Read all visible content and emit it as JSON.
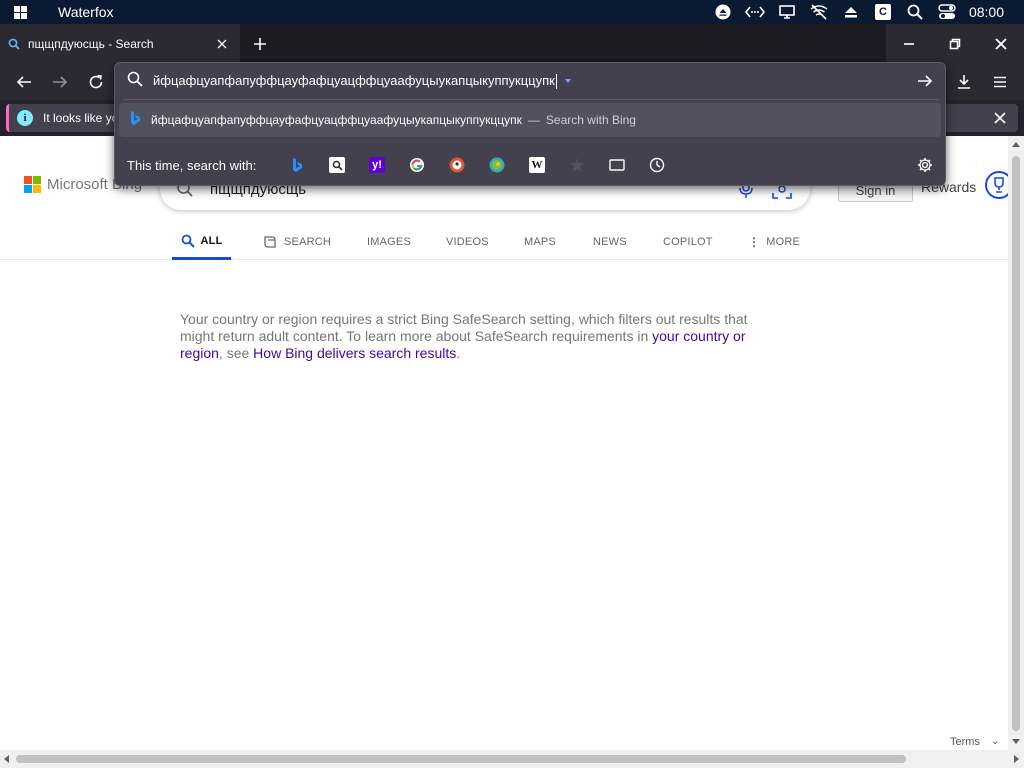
{
  "os": {
    "title": "Waterfox",
    "clock": "08:00",
    "tray_icons": [
      "eject-circle-icon",
      "network-code-icon",
      "monitor-icon",
      "no-wifi-icon",
      "eject-icon",
      "c-app-icon",
      "search-icon",
      "toggle-icon"
    ]
  },
  "tab": {
    "label": "пщщпдуюсщь - Search"
  },
  "notification": {
    "text": "It looks like yo"
  },
  "urlbar": {
    "value": "йфцафцуапфапуффцауфафцуацффцуаафуцыукапцыкуппукццупк",
    "suggestion_text": "йфцафцуапфапуффцауфафцуацффцуаафуцыукапцыкуппукццупк",
    "suggestion_sep": "—",
    "suggestion_action": "Search with Bing",
    "oneoff_label": "This time, search with:",
    "engines": [
      "bing",
      "search-box",
      "yahoo",
      "google",
      "duckduckgo",
      "ecosia",
      "wikipedia",
      "bookmarks",
      "tabs",
      "history"
    ]
  },
  "bing": {
    "logo_text": "Microsoft Bing",
    "query": "пщщпдуюсщь",
    "signin": "Sign in",
    "rewards": "Rewards",
    "scopes": [
      "ALL",
      "SEARCH",
      "IMAGES",
      "VIDEOS",
      "MAPS",
      "NEWS",
      "COPILOT",
      "MORE"
    ],
    "safesearch": {
      "part1": "Your country or region requires a strict Bing SafeSearch setting, which filters out results that might return adult content. To learn more about SafeSearch requirements in ",
      "link1": "your country or region",
      "part2": ", see ",
      "link2": "How Bing delivers search results",
      "part3": "."
    },
    "footer_terms": "Terms"
  },
  "colors": {
    "accent_blue": "#174ae4",
    "link_purple": "#4007a2",
    "notif_stripe": "#ff6bba",
    "toolbar": "#2b2a33"
  }
}
